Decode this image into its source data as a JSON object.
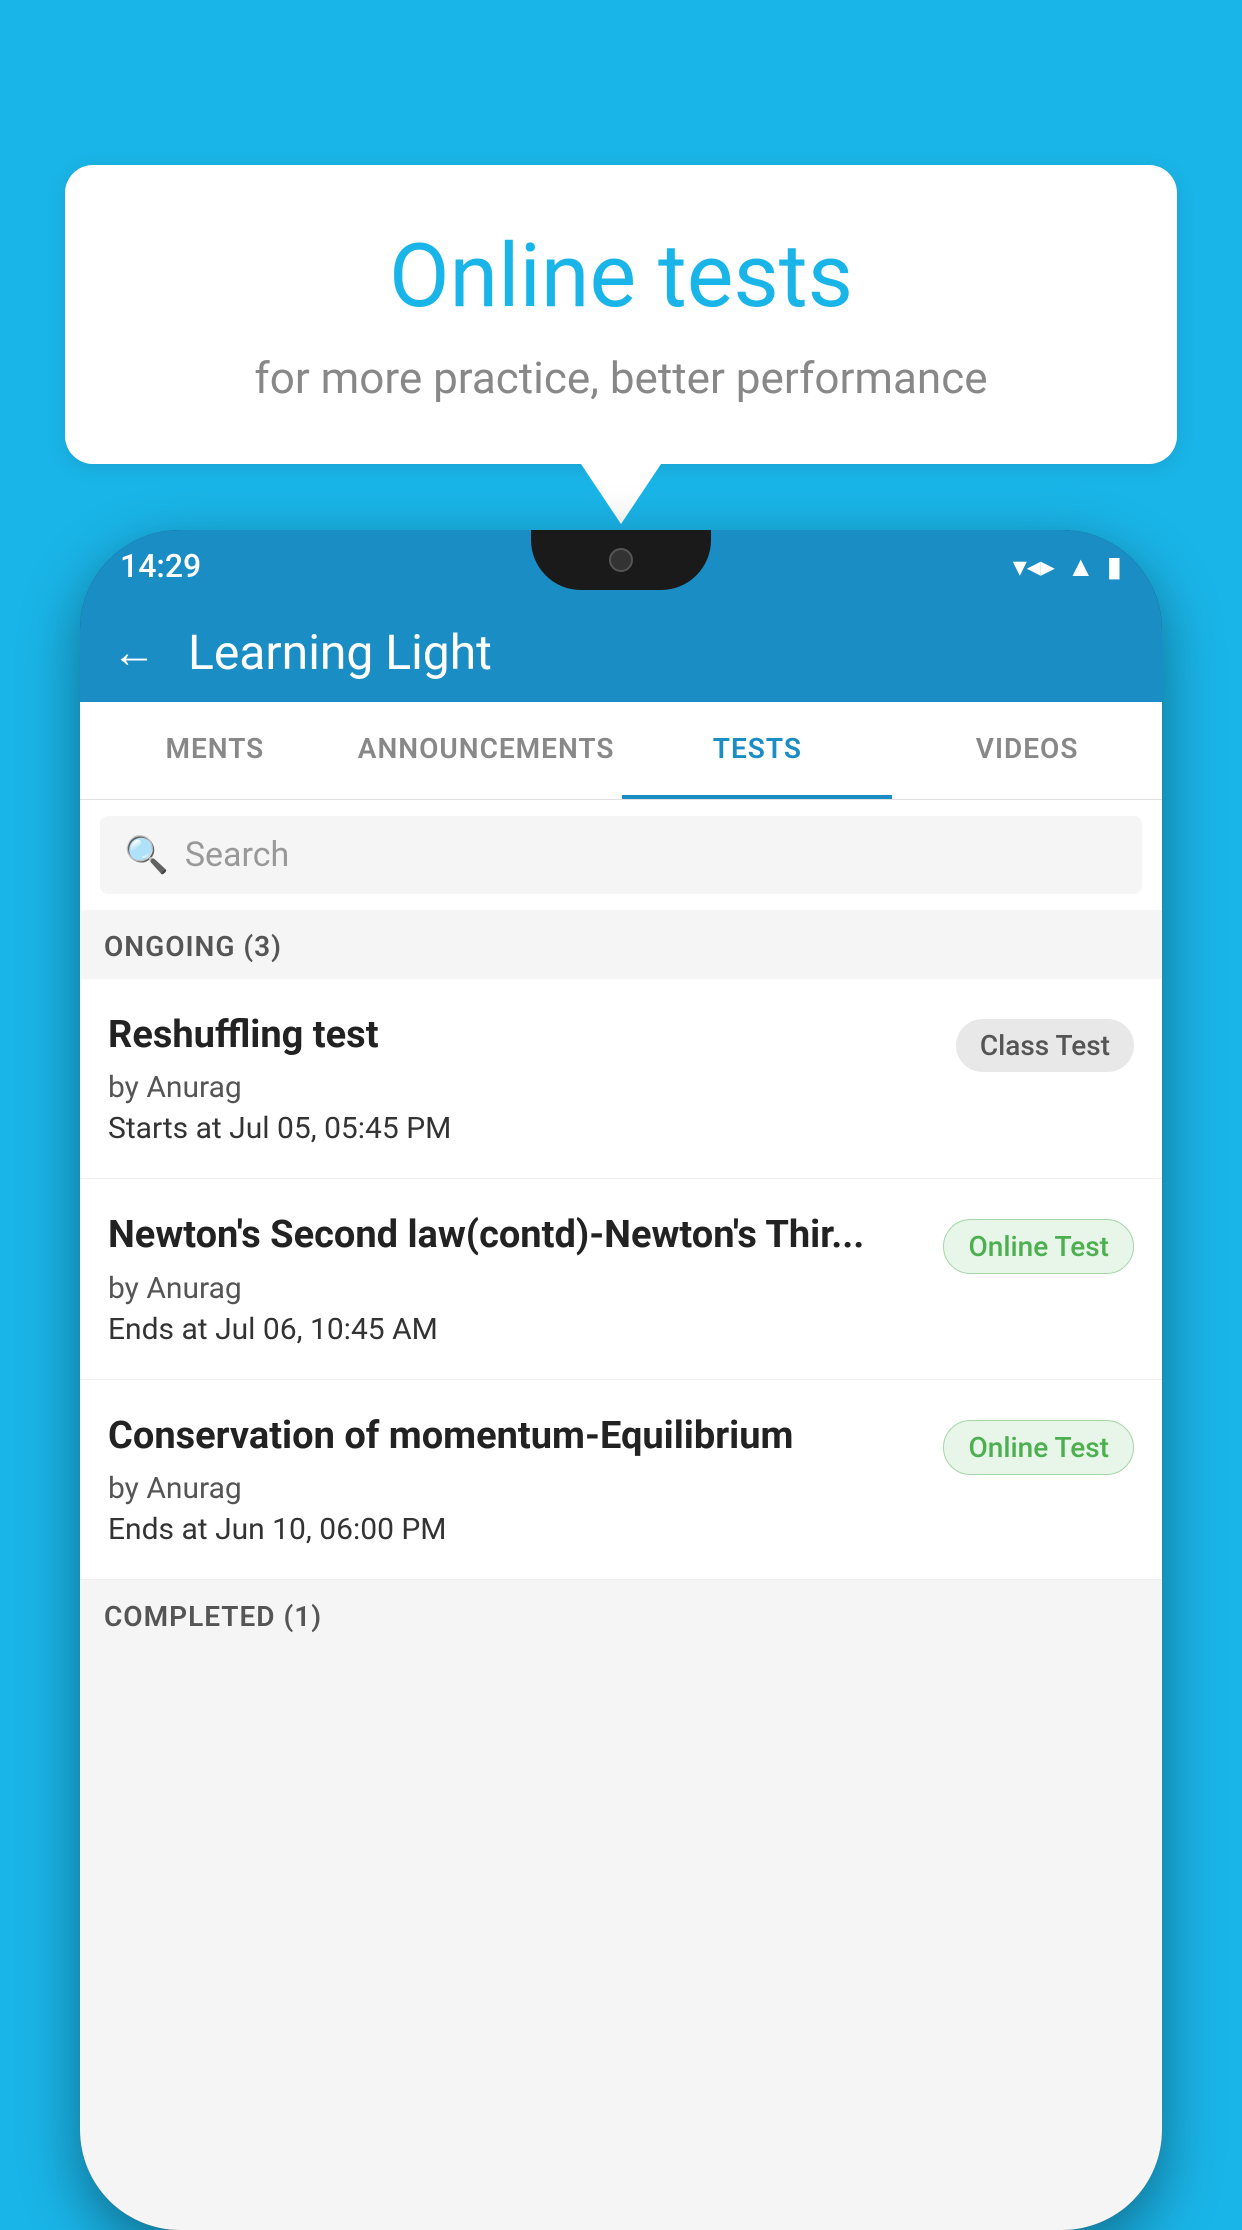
{
  "background_color": "#1ab5e8",
  "speech_bubble": {
    "title": "Online tests",
    "subtitle": "for more practice, better performance"
  },
  "phone": {
    "status_bar": {
      "time": "14:29",
      "wifi": "▼▲",
      "signal": "▲",
      "battery": "▮"
    },
    "header": {
      "back_label": "←",
      "title": "Learning Light"
    },
    "tabs": [
      {
        "label": "MENTS",
        "active": false
      },
      {
        "label": "ANNOUNCEMENTS",
        "active": false
      },
      {
        "label": "TESTS",
        "active": true
      },
      {
        "label": "VIDEOS",
        "active": false
      }
    ],
    "search": {
      "placeholder": "Search"
    },
    "ongoing_section": {
      "label": "ONGOING (3)",
      "tests": [
        {
          "name": "Reshuffling test",
          "author": "by Anurag",
          "date_label": "Starts at",
          "date": "Jul 05, 05:45 PM",
          "badge": "Class Test",
          "badge_type": "class"
        },
        {
          "name": "Newton's Second law(contd)-Newton's Thir...",
          "author": "by Anurag",
          "date_label": "Ends at",
          "date": "Jul 06, 10:45 AM",
          "badge": "Online Test",
          "badge_type": "online"
        },
        {
          "name": "Conservation of momentum-Equilibrium",
          "author": "by Anurag",
          "date_label": "Ends at",
          "date": "Jun 10, 06:00 PM",
          "badge": "Online Test",
          "badge_type": "online"
        }
      ]
    },
    "completed_section": {
      "label": "COMPLETED (1)"
    }
  }
}
